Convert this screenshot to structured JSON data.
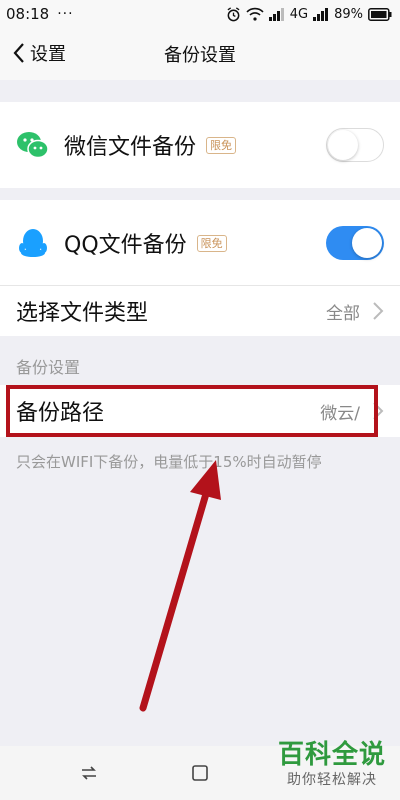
{
  "status": {
    "time": "08:18",
    "dots": "···",
    "network": "4G",
    "battery": "89%"
  },
  "nav": {
    "back_label": "设置",
    "title": "备份设置"
  },
  "wechat": {
    "label": "微信文件备份",
    "badge": "限免",
    "toggle_on": false
  },
  "qq": {
    "label": "QQ文件备份",
    "badge": "限免",
    "toggle_on": true
  },
  "file_type": {
    "label": "选择文件类型",
    "value": "全部"
  },
  "section": {
    "header": "备份设置"
  },
  "backup_path": {
    "label": "备份路径",
    "value": "微云/"
  },
  "footnote": "只会在WIFI下备份，电量低于15%时自动暂停",
  "watermark": {
    "title": "百科全说",
    "subtitle": "助你轻松解决"
  },
  "colors": {
    "accent_blue": "#2f8cf2",
    "highlight_red": "#b3121b",
    "wechat_green": "#2dc16a",
    "qq_blue": "#1aa0ff"
  }
}
